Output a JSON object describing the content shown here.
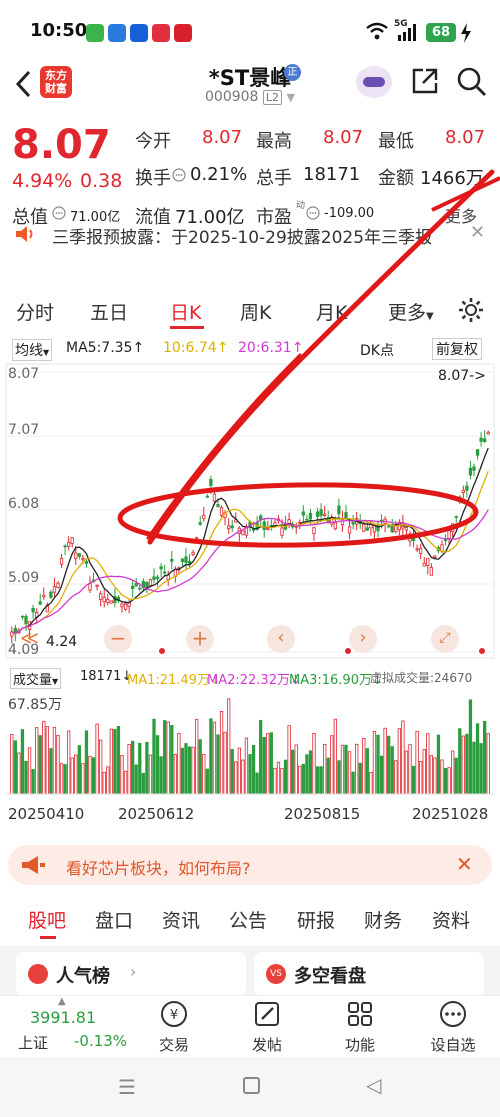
{
  "status": {
    "time": "10:50",
    "battery": "68",
    "signal": "5G"
  },
  "header": {
    "title": "*ST景峰",
    "badge": "正",
    "code": "000908",
    "level": "L2",
    "logo_line1": "东方",
    "logo_line2": "财富"
  },
  "quote": {
    "price": "8.07",
    "change_pct": "4.94%",
    "change": "0.38",
    "open_label": "今开",
    "open": "8.07",
    "high_label": "最高",
    "high": "8.07",
    "low_label": "最低",
    "low": "8.07",
    "turnover_label": "换手",
    "turnover": "0.21%",
    "volume_label": "总手",
    "volume": "18171",
    "amount_label": "金额",
    "amount": "1466万",
    "mktcap_label": "总值",
    "mktcap": "71.00亿",
    "float_label": "流值",
    "float_cap": "71.00亿",
    "pe_label": "市盈",
    "pe_sup": "动",
    "pe": "-109.00",
    "more": "更多"
  },
  "notice": {
    "text": "三季报预披露：于2025-10-29披露2025年三季报"
  },
  "chart_tabs": [
    "分时",
    "五日",
    "日K",
    "周K",
    "月K",
    "更多"
  ],
  "chart_head": {
    "ma_selector": "均线",
    "ma5": "MA5:7.35↑",
    "ma10": "10:6.74↑",
    "ma20": "20:6.31↑",
    "dk": "DK点",
    "adjust": "前复权"
  },
  "chart_data": {
    "type": "candlestick",
    "y_ticks": [
      "8.07",
      "7.07",
      "6.08",
      "5.09",
      "4.09"
    ],
    "ylim": [
      4.09,
      8.07
    ],
    "max_label": "8.07->",
    "min_label": "4.24",
    "x_ticks": [
      "20250410",
      "20250612",
      "20250815",
      "20251028"
    ]
  },
  "volume_head": {
    "selector": "成交量",
    "vol": "18171↓",
    "ma1": "MA1:21.49万↓",
    "ma2": "MA2:22.32万↓",
    "ma3": "MA3:16.90万↓",
    "virtual": "虚拟成交量:24670",
    "max_label": "67.85万"
  },
  "banner": {
    "text": "看好芯片板块，如何布局?"
  },
  "bottom_tabs": [
    "股吧",
    "盘口",
    "资讯",
    "公告",
    "研报",
    "财务",
    "资料"
  ],
  "cards": {
    "left": "人气榜",
    "right": "多空看盘"
  },
  "index": {
    "value": "3991.81",
    "name": "上证",
    "change": "-0.13%"
  },
  "nav": [
    "交易",
    "发帖",
    "功能",
    "设自选"
  ],
  "colors": {
    "up": "#e0262e",
    "down": "#2a9d3f",
    "ma5": "#222222",
    "ma10": "#e0b000",
    "ma20": "#d23ad2"
  }
}
